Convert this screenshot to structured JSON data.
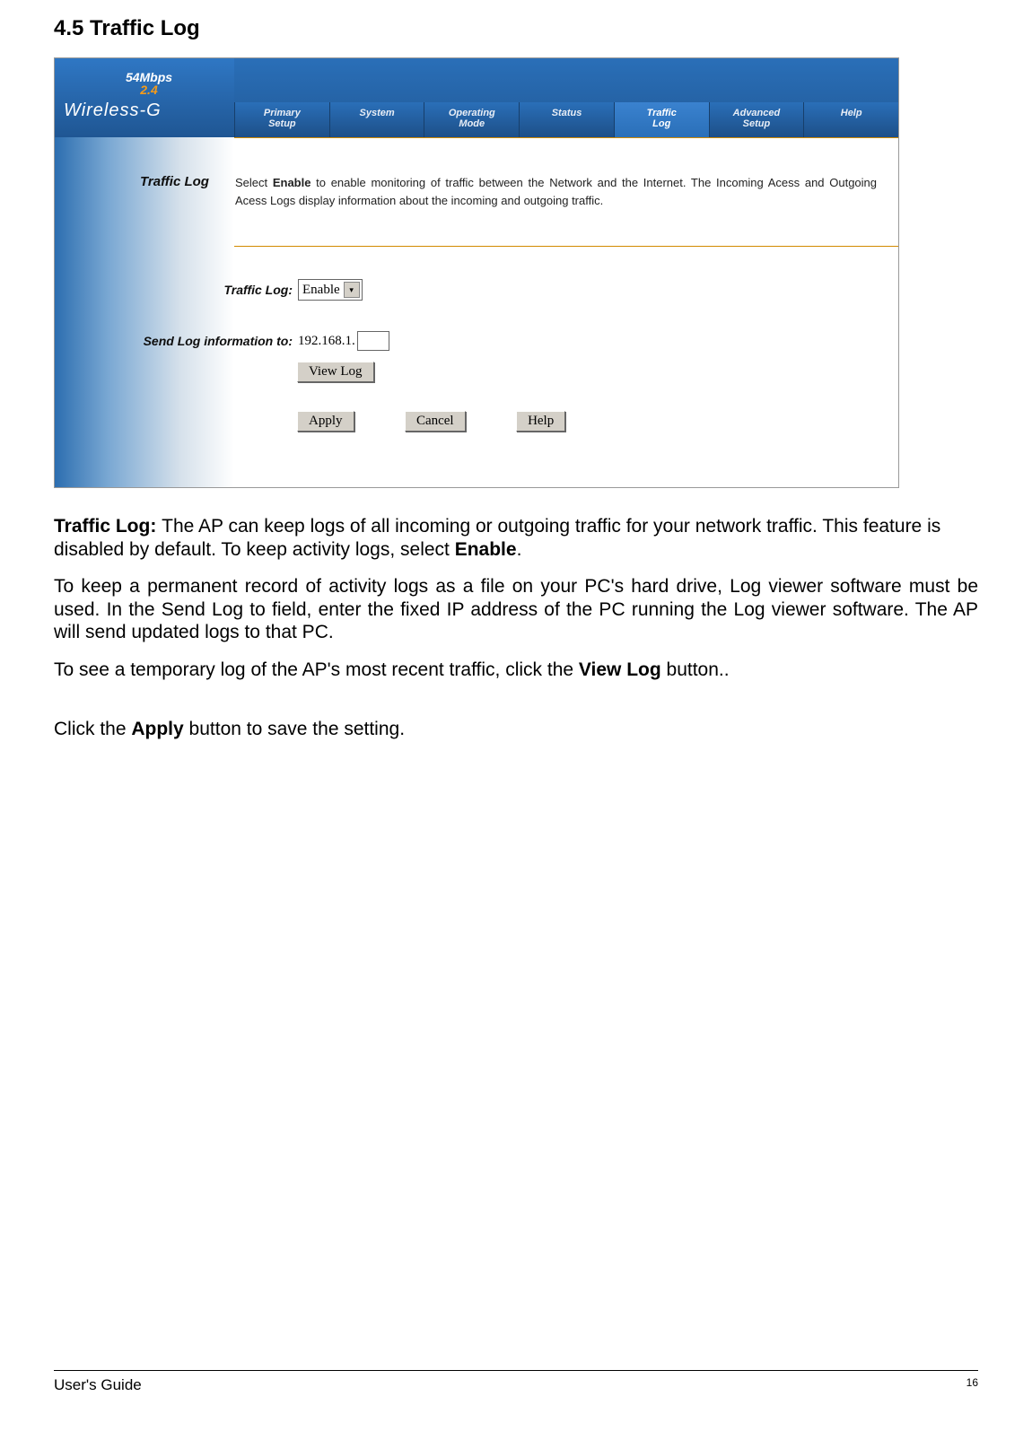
{
  "heading": "4.5 Traffic Log",
  "app": {
    "logo": {
      "mbps": "54Mbps",
      "band": "2.4",
      "brand": "Wireless-G"
    },
    "tabs": [
      "Primary\nSetup",
      "System",
      "Operating\nMode",
      "Status",
      "Traffic\nLog",
      "Advanced\nSetup",
      "Help"
    ],
    "active_tab": 4,
    "section_title": "Traffic Log",
    "section_desc_pre": "Select ",
    "section_desc_bold": "Enable",
    "section_desc_post": " to enable monitoring of traffic between the Network and the Internet. The Incoming Acess and Outgoing Acess Logs display information about the incoming and outgoing traffic.",
    "form": {
      "traffic_log_label": "Traffic Log:",
      "traffic_log_value": "Enable",
      "send_to_label": "Send Log information to:",
      "ip_prefix": "192.168.1.",
      "view_log_btn": "View Log",
      "apply_btn": "Apply",
      "cancel_btn": "Cancel",
      "help_btn": "Help"
    }
  },
  "doc": {
    "p1_lead": "Traffic Log: ",
    "p1_rest_a": "The AP can keep logs of all incoming or outgoing traffic for your network traffic. This feature is disabled by default. To keep activity logs, select ",
    "p1_rest_bold": "Enable",
    "p1_rest_end": ".",
    "p2": "To keep a permanent record of activity logs as a file on your PC's hard drive, Log viewer software must be used. In the Send Log to field, enter the fixed IP address of the PC running the Log viewer software. The AP will send updated logs to that PC.",
    "p3_pre": "To see a temporary log of the AP's most recent traffic, click the ",
    "p3_bold": "View Log",
    "p3_post": " button..",
    "p4_pre": "Click the ",
    "p4_bold": "Apply",
    "p4_post": " button to save the setting."
  },
  "footer": {
    "left": "User's Guide",
    "page": "16"
  }
}
